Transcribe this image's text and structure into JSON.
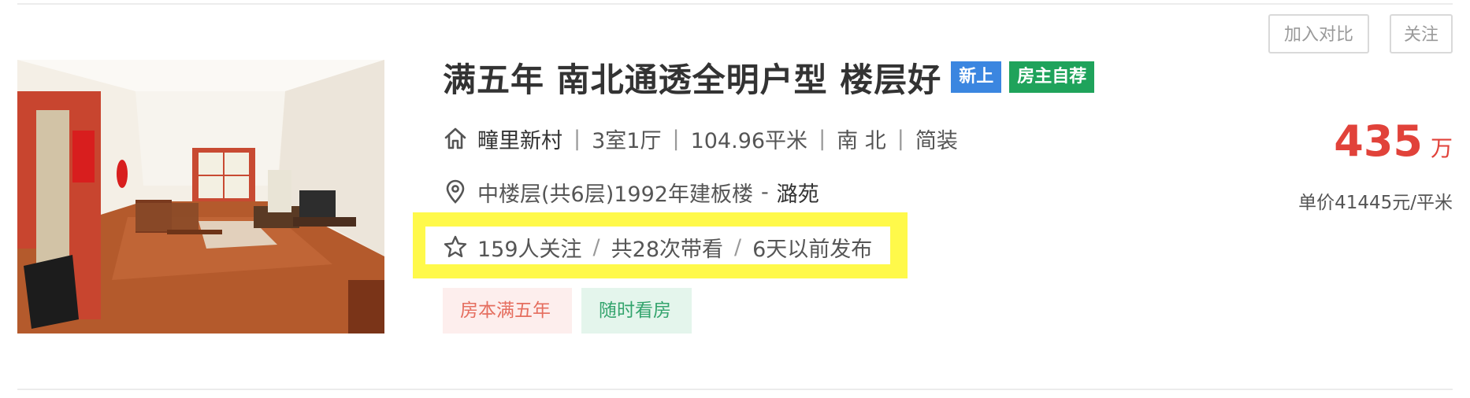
{
  "listing": {
    "title": "满五年 南北通透全明户型 楼层好",
    "badges": {
      "new": "新上",
      "owner": "房主自荐"
    },
    "info": {
      "community": "疃里新村",
      "layout": "3室1厅",
      "area": "104.96平米",
      "orientation": "南 北",
      "decoration": "简装",
      "separator": "|"
    },
    "position": {
      "floor_year": "中楼层(共6层)1992年建板楼",
      "dash": "-",
      "district": "潞苑"
    },
    "follow": {
      "followers": "159人关注",
      "visits": "共28次带看",
      "published": "6天以前发布",
      "separator": "/"
    },
    "tags": [
      "房本满五年",
      "随时看房"
    ],
    "price": {
      "total": "435",
      "unit": "万",
      "unit_price": "单价41445元/平米"
    },
    "actions": {
      "compare": "加入对比",
      "follow": "关注"
    }
  },
  "colors": {
    "price": "#e1423a",
    "badge_new": "#3b86e0",
    "badge_owner": "#1fa35b",
    "highlight": "#fff94a",
    "tag_years_text": "#e56e5f",
    "tag_years_bg": "#fdeeed",
    "tag_anytime_text": "#33a46d",
    "tag_anytime_bg": "#e4f5ec"
  },
  "icons": {
    "community": "house-icon",
    "location": "location-pin-icon",
    "follow": "star-icon"
  }
}
